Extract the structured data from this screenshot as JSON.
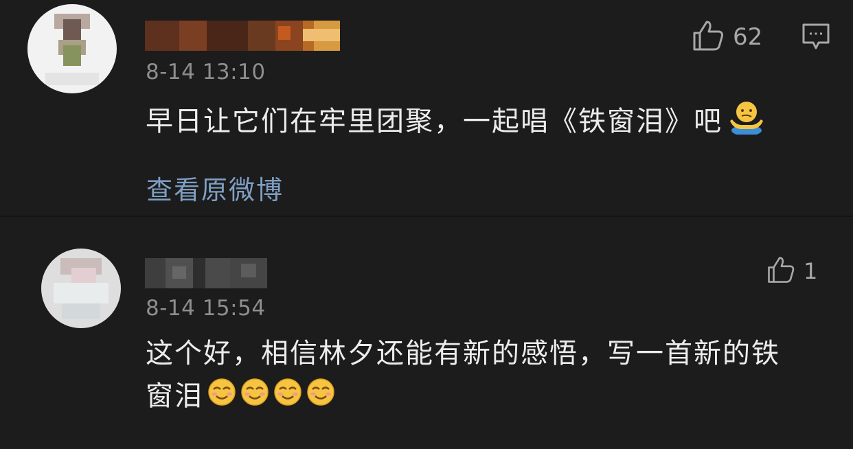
{
  "comments": [
    {
      "time": "8-14 13:10",
      "content": "早日让它们在牢里团聚，一起唱《铁窗泪》吧",
      "content_emoji": "shrugging-person-emoji",
      "likes": "62",
      "link": "查看原微博",
      "avatar_colors": [
        "#e8e8e8",
        "#b5a49a",
        "#6f5f55",
        "#8a9a6a"
      ],
      "username_colors": [
        "#6b3a25",
        "#8a4a2a",
        "#5a3020",
        "#c87a30",
        "#e0a040",
        "#f0c070"
      ]
    },
    {
      "time": "8-14 15:54",
      "content_line1": "这个好，相信林夕还能有新的感悟，写一首新的铁",
      "content_line2": "窗泪",
      "content_emoji": "smiling-face-emoji",
      "emoji_count": 4,
      "likes": "1",
      "avatar_colors": [
        "#e6e6e6",
        "#d8c8c8",
        "#cfd8d8",
        "#bdbdbd"
      ],
      "username_colors": [
        "#4a4a4a",
        "#5a5a5a",
        "#3e3e3e",
        "#505050"
      ]
    }
  ],
  "icons": {
    "like": "thumbs-up-icon",
    "reply": "comment-icon"
  }
}
